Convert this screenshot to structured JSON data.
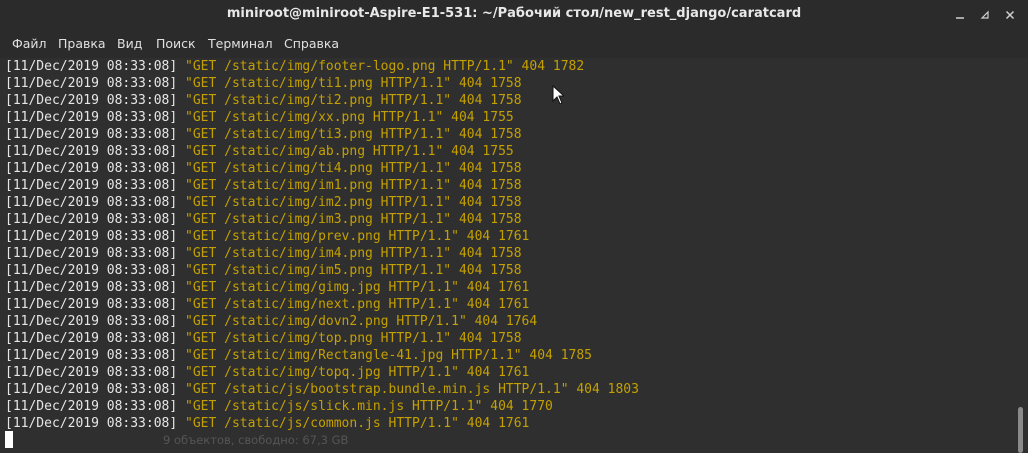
{
  "window": {
    "title": "miniroot@miniroot-Aspire-E1-531: ~/Рабочий стол/new_rest_django/caratcard",
    "controls": [
      "minimize-icon",
      "restore-icon",
      "close-icon"
    ]
  },
  "menu": [
    "Файл",
    "Правка",
    "Вид",
    "Поиск",
    "Терминал",
    "Справка"
  ],
  "terminal": {
    "lines": [
      {
        "ts": "[11/Dec/2019 08:33:08]",
        "req": "\"GET /static/img/footer-logo.png HTTP/1.1\" 404 1782"
      },
      {
        "ts": "[11/Dec/2019 08:33:08]",
        "req": "\"GET /static/img/ti1.png HTTP/1.1\" 404 1758"
      },
      {
        "ts": "[11/Dec/2019 08:33:08]",
        "req": "\"GET /static/img/ti2.png HTTP/1.1\" 404 1758"
      },
      {
        "ts": "[11/Dec/2019 08:33:08]",
        "req": "\"GET /static/img/xx.png HTTP/1.1\" 404 1755"
      },
      {
        "ts": "[11/Dec/2019 08:33:08]",
        "req": "\"GET /static/img/ti3.png HTTP/1.1\" 404 1758"
      },
      {
        "ts": "[11/Dec/2019 08:33:08]",
        "req": "\"GET /static/img/ab.png HTTP/1.1\" 404 1755"
      },
      {
        "ts": "[11/Dec/2019 08:33:08]",
        "req": "\"GET /static/img/ti4.png HTTP/1.1\" 404 1758"
      },
      {
        "ts": "[11/Dec/2019 08:33:08]",
        "req": "\"GET /static/img/im1.png HTTP/1.1\" 404 1758"
      },
      {
        "ts": "[11/Dec/2019 08:33:08]",
        "req": "\"GET /static/img/im2.png HTTP/1.1\" 404 1758"
      },
      {
        "ts": "[11/Dec/2019 08:33:08]",
        "req": "\"GET /static/img/im3.png HTTP/1.1\" 404 1758"
      },
      {
        "ts": "[11/Dec/2019 08:33:08]",
        "req": "\"GET /static/img/prev.png HTTP/1.1\" 404 1761"
      },
      {
        "ts": "[11/Dec/2019 08:33:08]",
        "req": "\"GET /static/img/im4.png HTTP/1.1\" 404 1758"
      },
      {
        "ts": "[11/Dec/2019 08:33:08]",
        "req": "\"GET /static/img/im5.png HTTP/1.1\" 404 1758"
      },
      {
        "ts": "[11/Dec/2019 08:33:08]",
        "req": "\"GET /static/img/gimg.jpg HTTP/1.1\" 404 1761"
      },
      {
        "ts": "[11/Dec/2019 08:33:08]",
        "req": "\"GET /static/img/next.png HTTP/1.1\" 404 1761"
      },
      {
        "ts": "[11/Dec/2019 08:33:08]",
        "req": "\"GET /static/img/dovn2.png HTTP/1.1\" 404 1764"
      },
      {
        "ts": "[11/Dec/2019 08:33:08]",
        "req": "\"GET /static/img/top.png HTTP/1.1\" 404 1758"
      },
      {
        "ts": "[11/Dec/2019 08:33:08]",
        "req": "\"GET /static/img/Rectangle-41.jpg HTTP/1.1\" 404 1785"
      },
      {
        "ts": "[11/Dec/2019 08:33:08]",
        "req": "\"GET /static/img/topq.jpg HTTP/1.1\" 404 1761"
      },
      {
        "ts": "[11/Dec/2019 08:33:08]",
        "req": "\"GET /static/js/bootstrap.bundle.min.js HTTP/1.1\" 404 1803"
      },
      {
        "ts": "[11/Dec/2019 08:33:08]",
        "req": "\"GET /static/js/slick.min.js HTTP/1.1\" 404 1770"
      },
      {
        "ts": "[11/Dec/2019 08:33:08]",
        "req": "\"GET /static/js/common.js HTTP/1.1\" 404 1761"
      }
    ],
    "overlay_text": "9 объектов, свободно: 67,3 GB"
  }
}
